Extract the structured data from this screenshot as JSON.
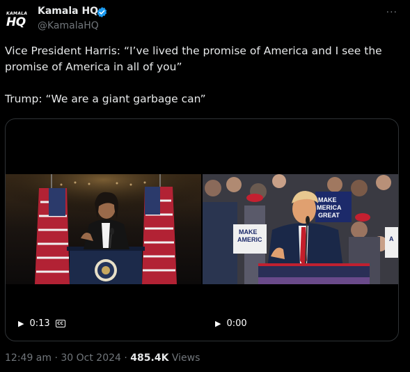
{
  "author": {
    "avatar_text_top": "KAMALA",
    "avatar_text_bottom": "HQ",
    "name": "Kamala HQ",
    "handle": "@KamalaHQ",
    "verified_icon": "verified-badge-icon",
    "more_icon": "more-icon",
    "more_glyph": "···"
  },
  "tweet": {
    "text": "Vice President Harris: “I’ve lived the promise of America and I see the promise of America in all of you”\n\nTrump: “We are a giant garbage can”"
  },
  "media": {
    "videos": [
      {
        "duration": "0:13",
        "has_captions": true
      },
      {
        "duration": "0:00",
        "has_captions": false
      }
    ]
  },
  "meta": {
    "time": "12:49 am",
    "date": "30 Oct 2024",
    "separator": "·",
    "views_count": "485.4K",
    "views_label": "Views"
  },
  "colors": {
    "background": "#000000",
    "text": "#e7e9ea",
    "secondary": "#71767b",
    "verified": "#1d9bf0",
    "border": "#2f3336"
  }
}
